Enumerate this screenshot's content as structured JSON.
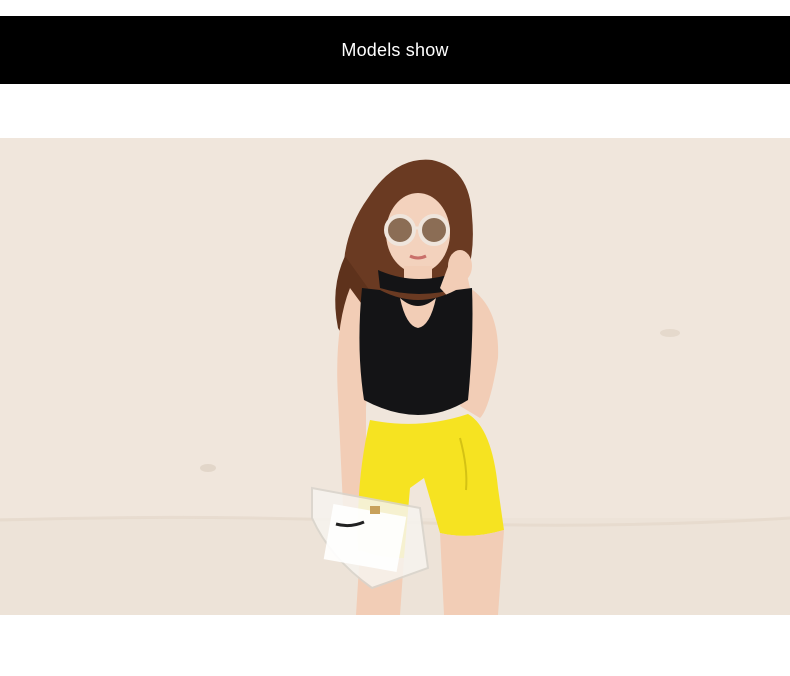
{
  "header": {
    "title": "Models show"
  },
  "photo": {
    "subject": "model-photo",
    "colors": {
      "wall": "#f0e6dc",
      "top": "#141416",
      "shorts": "#f6e321",
      "hair": "#6a3a22",
      "skin": "#f2cdb6"
    }
  }
}
